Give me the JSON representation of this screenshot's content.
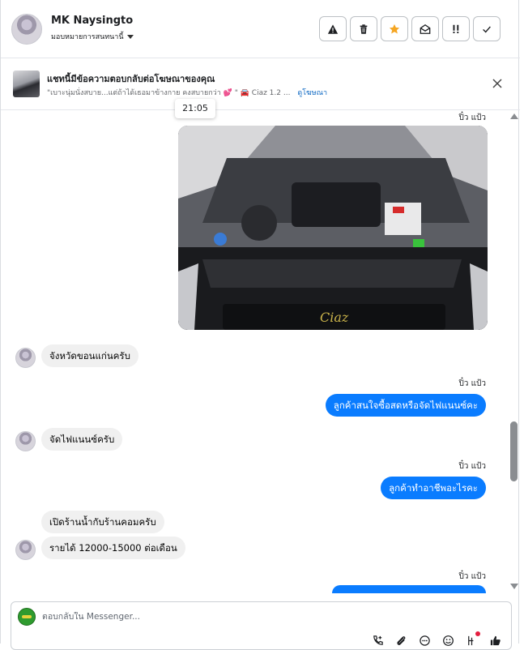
{
  "header": {
    "contact_name": "MK Naysingto",
    "assign_label": "มอบหมายการสนทนานี้",
    "toolbar": [
      {
        "name": "warning-icon",
        "glyph": "⚠"
      },
      {
        "name": "trash-icon",
        "glyph": "🗑"
      },
      {
        "name": "star-icon",
        "glyph": "★",
        "color": "#f5a623"
      },
      {
        "name": "mark-unread-icon",
        "glyph": "✉"
      },
      {
        "name": "follow-up-icon",
        "glyph": "!"
      },
      {
        "name": "check-icon",
        "glyph": "✓"
      }
    ]
  },
  "ad": {
    "title": "แชทนี้มีข้อความตอบกลับต่อโฆษณาของคุณ",
    "snippet": "\"เบาะนุ่มนั่งสบาย...แต่ถ้าได้เธอมาข้างกาย คงสบายกว่า 💕 \" 🚘 Ciaz 1.2 ...",
    "link": "ดูโฆษณา"
  },
  "tooltip_time": "21:05",
  "conversation": {
    "sender_label": "ปิ๋ว แป้ว",
    "image_caption_text": "Ciaz",
    "messages": [
      {
        "dir": "in",
        "text": "จังหวัดขอนแก่นครับ"
      },
      {
        "dir": "out",
        "text": "ลูกค้าสนใจซื้อสดหรือจัดไฟแนนซ์คะ"
      },
      {
        "dir": "in",
        "text": "จัดไฟแนนซ์ครับ"
      },
      {
        "dir": "out",
        "text": "ลูกค้าทำอาชีพอะไรคะ"
      },
      {
        "dir": "in",
        "text": "เปิดร้านน้ำกับร้านคอมครับ"
      },
      {
        "dir": "in",
        "text": "รายได้ 12000-15000 ต่อเดือน"
      }
    ]
  },
  "composer": {
    "placeholder": "ตอบกลับใน Messenger..."
  },
  "colors": {
    "accent": "#0a7cff",
    "incoming_bubble": "#f0f0f0",
    "star": "#f5a623"
  }
}
